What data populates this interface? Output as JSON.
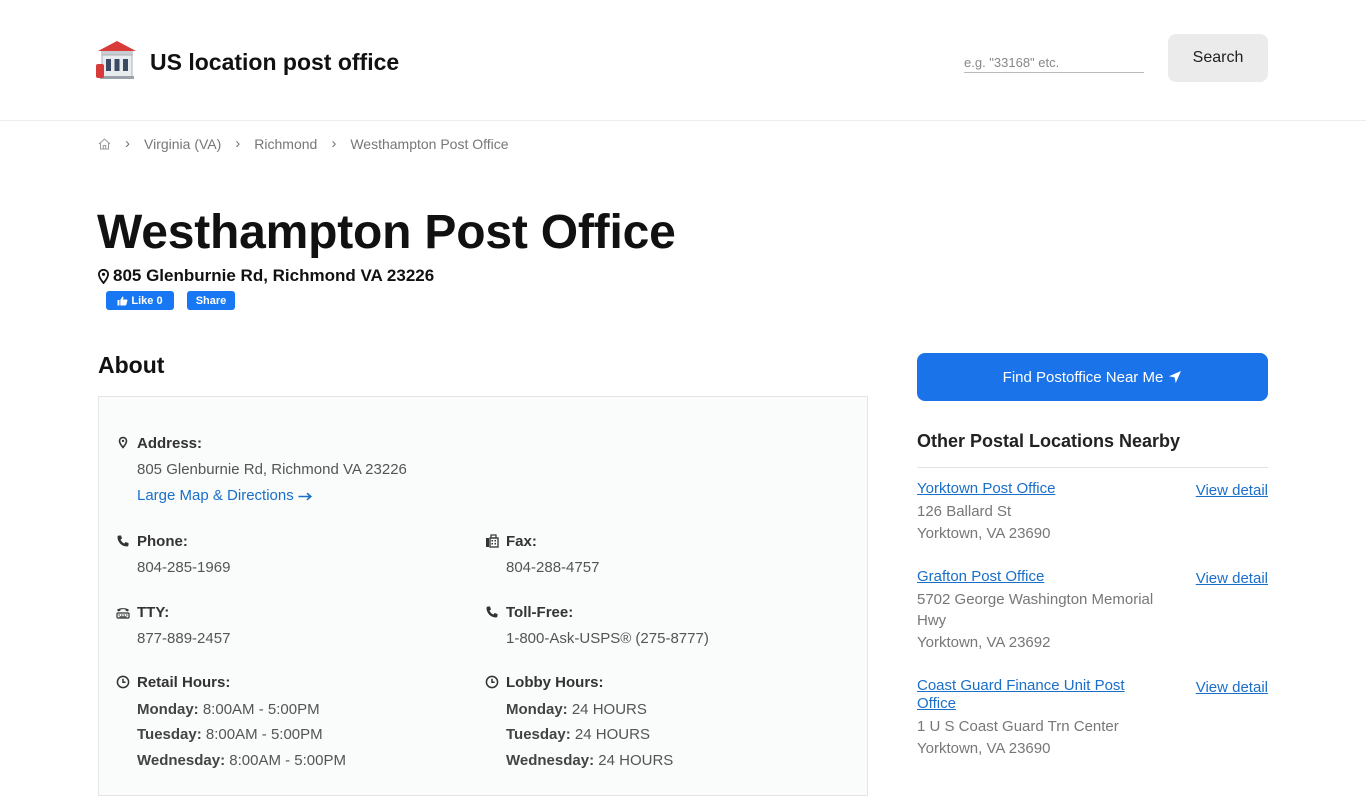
{
  "header": {
    "brand": "US location post office",
    "search_placeholder": "e.g. \"33168\" etc.",
    "search_label": "Search"
  },
  "breadcrumb": {
    "items": [
      "Virginia (VA)",
      "Richmond",
      "Westhampton Post Office"
    ]
  },
  "office": {
    "title": "Westhampton Post Office",
    "address": "805 Glenburnie Rd, Richmond VA 23226"
  },
  "social": {
    "like": "Like 0",
    "share": "Share"
  },
  "about": {
    "heading": "About",
    "address_label": "Address:",
    "address_value": "805 Glenburnie Rd, Richmond VA 23226",
    "map_link": "Large Map & Directions",
    "phone_label": "Phone:",
    "phone_value": "804-285-1969",
    "fax_label": "Fax:",
    "fax_value": "804-288-4757",
    "tty_label": "TTY:",
    "tty_value": "877-889-2457",
    "tollfree_label": "Toll-Free:",
    "tollfree_value": "1-800-Ask-USPS® (275-8777)",
    "retail_label": "Retail Hours:",
    "retail": [
      {
        "day": "Monday:",
        "hours": "8:00AM - 5:00PM"
      },
      {
        "day": "Tuesday:",
        "hours": "8:00AM - 5:00PM"
      },
      {
        "day": "Wednesday:",
        "hours": "8:00AM - 5:00PM"
      }
    ],
    "lobby_label": "Lobby Hours:",
    "lobby": [
      {
        "day": "Monday:",
        "hours": "24 HOURS"
      },
      {
        "day": "Tuesday:",
        "hours": "24 HOURS"
      },
      {
        "day": "Wednesday:",
        "hours": "24 HOURS"
      }
    ]
  },
  "sidebar": {
    "find_button": "Find Postoffice Near Me",
    "nearby_heading": "Other Postal Locations Nearby",
    "view_detail": "View detail",
    "locations": [
      {
        "name": "Yorktown Post Office",
        "street": "126 Ballard St",
        "city": "Yorktown, VA 23690"
      },
      {
        "name": "Grafton Post Office",
        "street": "5702 George Washington Memorial Hwy",
        "city": "Yorktown, VA 23692"
      },
      {
        "name": "Coast Guard Finance Unit Post Office",
        "street": "1 U S Coast Guard Trn Center",
        "city": "Yorktown, VA 23690"
      }
    ]
  },
  "colors": {
    "link": "#1a6fc9",
    "primary_button": "#1a73e8",
    "facebook": "#1877f2"
  }
}
